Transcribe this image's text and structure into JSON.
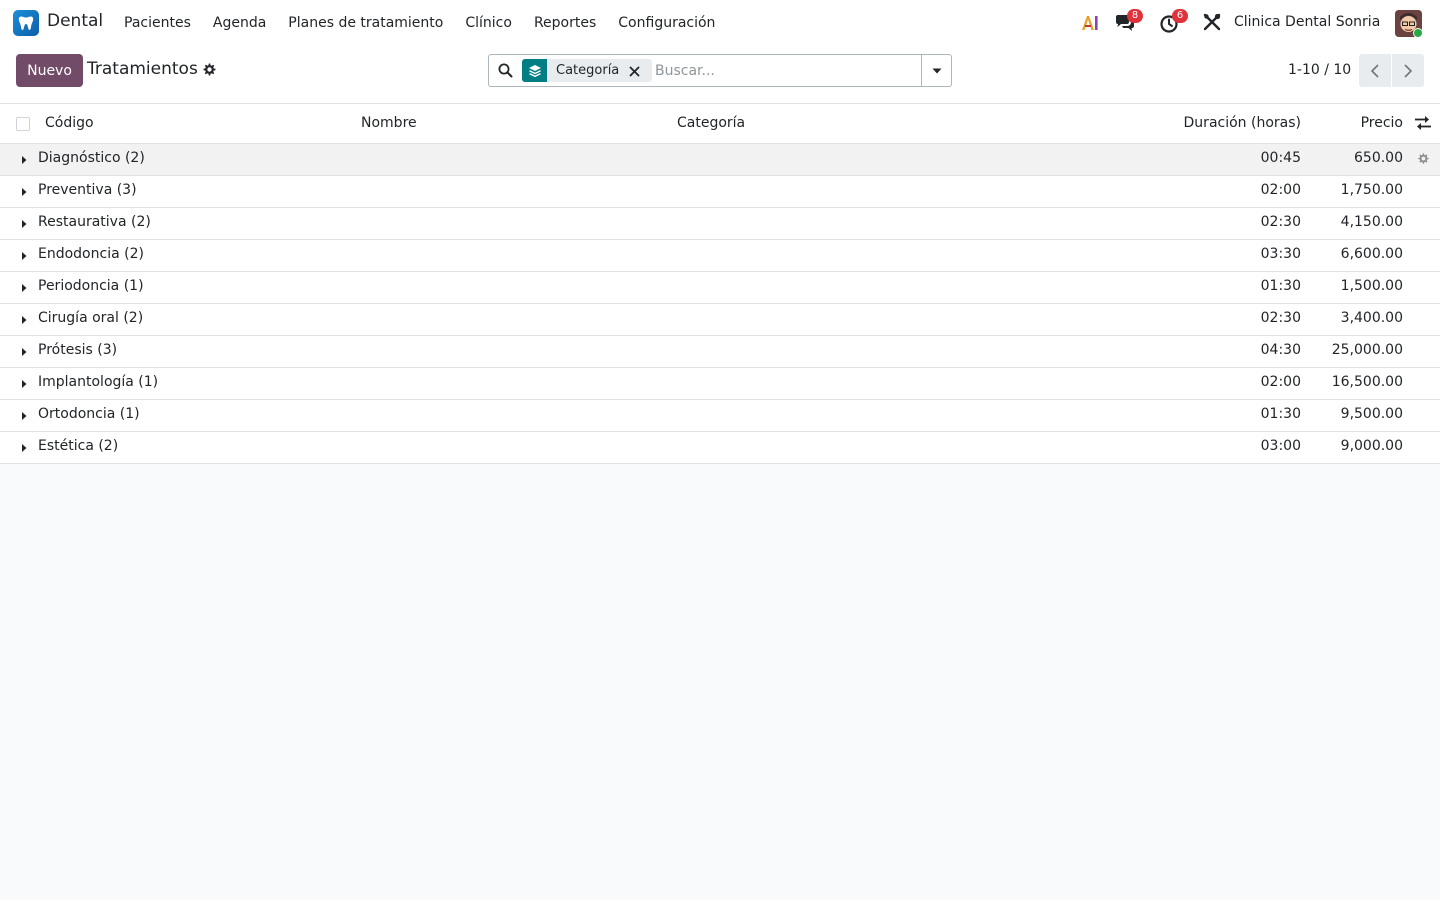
{
  "navbar": {
    "app_name": "Dental",
    "menu": [
      "Pacientes",
      "Agenda",
      "Planes de tratamiento",
      "Clínico",
      "Reportes",
      "Configuración"
    ],
    "messages_count": "8",
    "activities_count": "6",
    "company": "Clinica Dental Sonria"
  },
  "control_panel": {
    "new_button": "Nuevo",
    "title": "Tratamientos",
    "facet_label": "Categoría",
    "search_placeholder": "Buscar...",
    "pager": "1-10 / 10"
  },
  "list": {
    "columns": {
      "code": "Código",
      "name": "Nombre",
      "category": "Categoría",
      "duration": "Duración (horas)",
      "price": "Precio"
    },
    "groups": [
      {
        "label": "Diagnóstico (2)",
        "duration": "00:45",
        "price": "650.00"
      },
      {
        "label": "Preventiva (3)",
        "duration": "02:00",
        "price": "1,750.00"
      },
      {
        "label": "Restaurativa (2)",
        "duration": "02:30",
        "price": "4,150.00"
      },
      {
        "label": "Endodoncia (2)",
        "duration": "03:30",
        "price": "6,600.00"
      },
      {
        "label": "Periodoncia (1)",
        "duration": "01:30",
        "price": "1,500.00"
      },
      {
        "label": "Cirugía oral (2)",
        "duration": "02:30",
        "price": "3,400.00"
      },
      {
        "label": "Prótesis (3)",
        "duration": "04:30",
        "price": "25,000.00"
      },
      {
        "label": "Implantología (1)",
        "duration": "02:00",
        "price": "16,500.00"
      },
      {
        "label": "Ortodoncia (1)",
        "duration": "01:30",
        "price": "9,500.00"
      },
      {
        "label": "Estética (2)",
        "duration": "03:00",
        "price": "9,000.00"
      }
    ]
  },
  "colors": {
    "primary": "#714b67",
    "facet_accent": "#017e84",
    "badge": "#e0323c",
    "app_logo": "#1a8fd8"
  }
}
